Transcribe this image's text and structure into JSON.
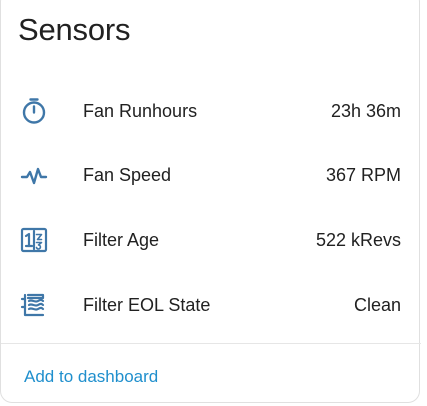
{
  "card": {
    "title": "Sensors",
    "action_label": "Add to dashboard"
  },
  "entities": [
    {
      "icon": "timer-icon",
      "label": "Fan Runhours",
      "value": "23h 36m"
    },
    {
      "icon": "pulse-icon",
      "label": "Fan Speed",
      "value": "367 RPM"
    },
    {
      "icon": "counter-icon",
      "label": "Filter Age",
      "value": "522 kRevs"
    },
    {
      "icon": "air-filter-icon",
      "label": "Filter EOL State",
      "value": "Clean"
    }
  ],
  "colors": {
    "icon": "#3f77a8",
    "accent": "#1f8fcd",
    "text": "#212121"
  }
}
